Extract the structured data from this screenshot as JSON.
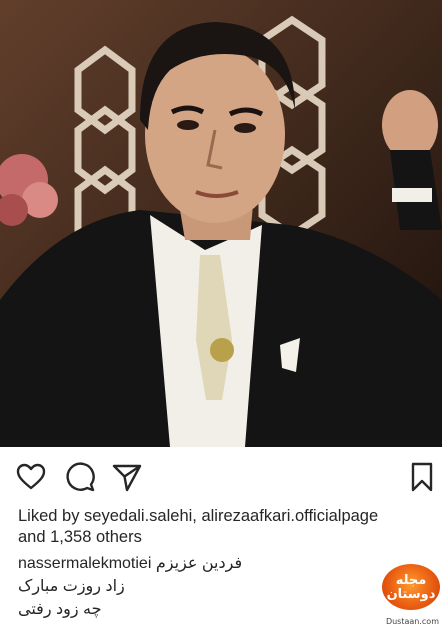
{
  "post": {
    "likes_prefix": "Liked by ",
    "liked_users": "seyedali.salehi, alirezaafkari.officialpage",
    "likes_suffix": "and 1,358 others",
    "author": "nassermalekmotiei",
    "caption_lines": [
      "فردین عزیزم",
      "زاد روزت مبارک",
      "چه زود رفتی"
    ]
  },
  "actions": {
    "like": "heart-icon",
    "comment": "comment-icon",
    "share": "share-icon",
    "save": "bookmark-icon"
  },
  "watermark": {
    "badge_text": "مجله دوستان",
    "url": "Dustaan.com"
  },
  "colors": {
    "text": "#262626",
    "watermark_orange": "#e85a10"
  }
}
